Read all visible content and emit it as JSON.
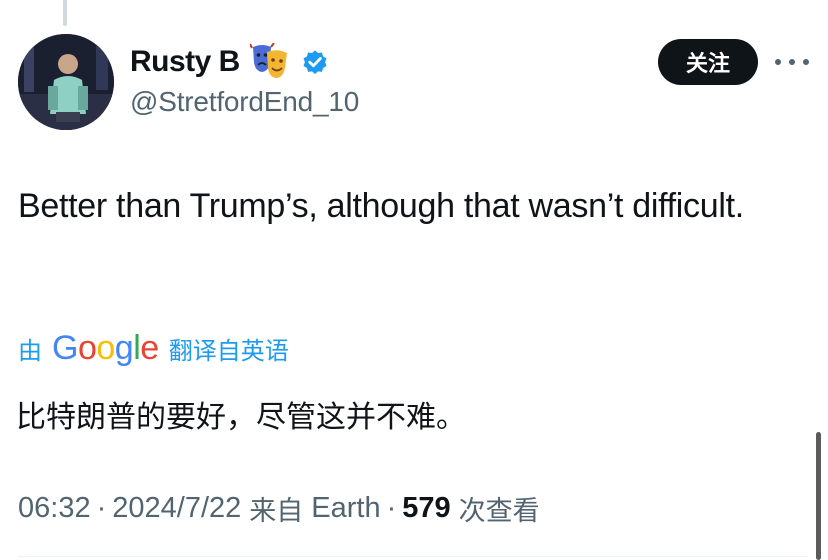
{
  "author": {
    "display_name": "Rusty B",
    "handle": "@StretfordEnd_10",
    "emoji_icon": "performing-arts-masks",
    "verified": true
  },
  "follow_button": {
    "label": "关注"
  },
  "more_menu_icon": "more-horizontal-icon",
  "tweet": {
    "text": "Better than Trump’s, although that wasn’t difficult."
  },
  "translation": {
    "prefix": "由",
    "provider_letters": [
      "G",
      "o",
      "o",
      "g",
      "l",
      "e"
    ],
    "suffix": "翻译自英语",
    "translated_text": "比特朗普的要好，尽管这并不难。"
  },
  "meta": {
    "time": "06:32",
    "separator": "·",
    "date": "2024/7/22",
    "source_prefix": "来自",
    "source": "Earth",
    "views_count": "579",
    "views_label": "次查看"
  },
  "colors": {
    "text_primary": "#0f1419",
    "text_secondary": "#536471",
    "link_blue": "#1d9bf0",
    "verified_blue": "#1d9bf0",
    "button_bg": "#0f1419"
  }
}
